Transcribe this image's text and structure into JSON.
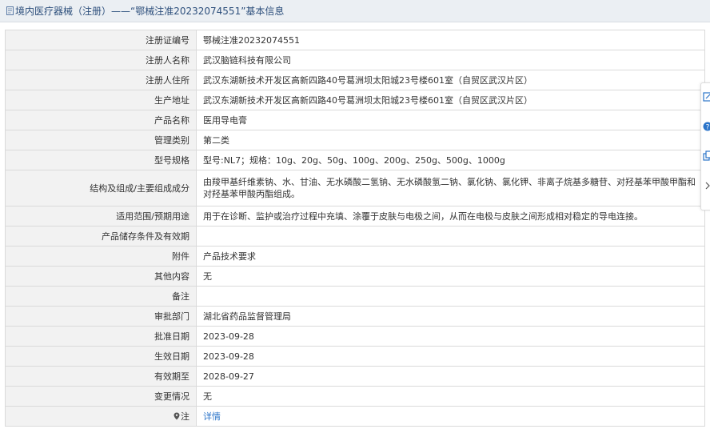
{
  "header": {
    "title": "境内医疗器械（注册）——“鄂械注准20232074551”基本信息"
  },
  "rows": [
    {
      "label": "注册证编号",
      "value": "鄂械注准20232074551"
    },
    {
      "label": "注册人名称",
      "value": "武汉脑链科技有限公司"
    },
    {
      "label": "注册人住所",
      "value": "武汉东湖新技术开发区高新四路40号葛洲坝太阳城23号楼601室（自贸区武汉片区）"
    },
    {
      "label": "生产地址",
      "value": "武汉东湖新技术开发区高新四路40号葛洲坝太阳城23号楼601室（自贸区武汉片区）"
    },
    {
      "label": "产品名称",
      "value": "医用导电膏"
    },
    {
      "label": "管理类别",
      "value": "第二类"
    },
    {
      "label": "型号规格",
      "value": "型号:NL7；规格：10g、20g、50g、100g、200g、250g、500g、1000g"
    },
    {
      "label": "结构及组成/主要组成成分",
      "value": "由羧甲基纤维素钠、水、甘油、无水磷酸二氢钠、无水磷酸氢二钠、氯化钠、氯化钾、非离子烷基多糖苷、对羟基苯甲酸甲酯和对羟基苯甲酸丙酯组成。"
    },
    {
      "label": "适用范围/预期用途",
      "value": "用于在诊断、监护或治疗过程中充填、涂覆于皮肤与电极之间，从而在电极与皮肤之间形成相对稳定的导电连接。"
    },
    {
      "label": "产品储存条件及有效期",
      "value": ""
    },
    {
      "label": "附件",
      "value": "产品技术要求"
    },
    {
      "label": "其他内容",
      "value": "无"
    },
    {
      "label": "备注",
      "value": ""
    },
    {
      "label": "审批部门",
      "value": "湖北省药品监督管理局"
    },
    {
      "label": "批准日期",
      "value": "2023-09-28"
    },
    {
      "label": "生效日期",
      "value": "2023-09-28"
    },
    {
      "label": "有效期至",
      "value": "2028-09-27"
    },
    {
      "label": "变更情况",
      "value": "无"
    },
    {
      "label": "注",
      "value": "详情"
    }
  ],
  "icons": {
    "title": "document-icon",
    "note": "map-pin-icon",
    "side_tools": [
      "edit-icon",
      "help-icon",
      "copy-icon",
      "chevron-right-icon"
    ]
  },
  "colors": {
    "title_text": "#2d4f7c",
    "label_bg": "#f2f2f2",
    "link": "#2b74c9",
    "border": "#dadada"
  }
}
